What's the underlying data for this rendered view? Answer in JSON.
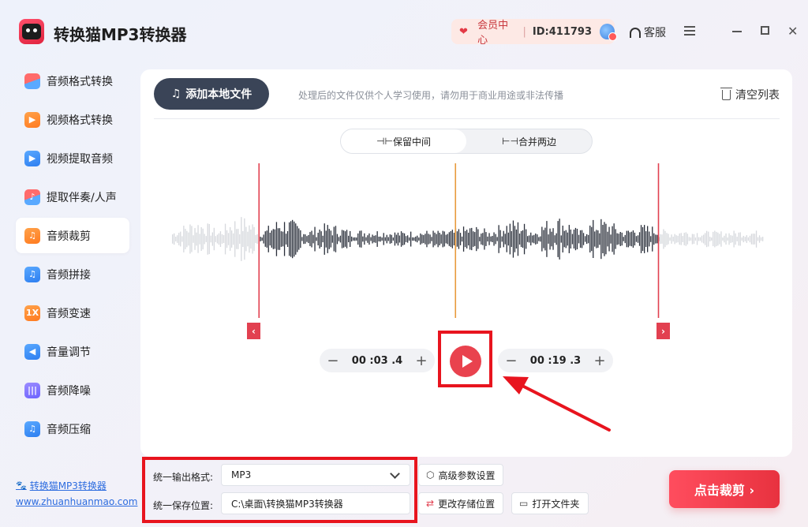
{
  "app": {
    "title": "转换猫MP3转换器",
    "logo_text": "转换猫"
  },
  "header": {
    "vip_label": "会员中心",
    "user_id": "ID:411793",
    "service_label": "客服"
  },
  "sidebar": {
    "items": [
      {
        "label": "音频格式转换",
        "icon": "audio-convert-icon",
        "badge": ""
      },
      {
        "label": "视频格式转换",
        "icon": "video-convert-icon",
        "badge": "▶"
      },
      {
        "label": "视频提取音频",
        "icon": "video-extract-icon",
        "badge": "▶"
      },
      {
        "label": "提取伴奏/人声",
        "icon": "vocal-extract-icon",
        "badge": "♪"
      },
      {
        "label": "音频裁剪",
        "icon": "audio-trim-icon",
        "badge": "♫"
      },
      {
        "label": "音频拼接",
        "icon": "audio-join-icon",
        "badge": "♫"
      },
      {
        "label": "音频变速",
        "icon": "audio-speed-icon",
        "badge": "1X"
      },
      {
        "label": "音量调节",
        "icon": "volume-icon",
        "badge": "◀"
      },
      {
        "label": "音频降噪",
        "icon": "denoise-icon",
        "badge": "|||"
      },
      {
        "label": "音频压缩",
        "icon": "compress-icon",
        "badge": "♫"
      }
    ],
    "active_index": 4,
    "footer_brand": "转换猫MP3转换器",
    "footer_site": "www.zhuanhuanmao.com"
  },
  "main": {
    "add_button": "添加本地文件",
    "note": "处理后的文件仅供个人学习使用，请勿用于商业用途或非法传播",
    "clear_label": "清空列表",
    "mode_keep": "保留中间",
    "mode_merge": "合并两边",
    "mode_active": "keep",
    "start_time": "00 :03 .4",
    "end_time": "00 :19 .3",
    "trim": {
      "start_fraction": 0.147,
      "playhead_fraction": 0.479,
      "end_fraction": 0.822
    }
  },
  "output": {
    "format_label": "统一输出格式:",
    "format_value": "MP3",
    "path_label": "统一保存位置:",
    "path_value": "C:\\桌面\\转换猫MP3转换器",
    "advanced_label": "高级参数设置",
    "change_path_label": "更改存储位置",
    "open_folder_label": "打开文件夹",
    "cut_button": "点击裁剪 ›"
  },
  "colors": {
    "accent": "#e9424e",
    "dark_button": "#3a4457",
    "trim_line": "#e24050",
    "playhead": "#e89a3c",
    "annotation": "#e8141e"
  }
}
